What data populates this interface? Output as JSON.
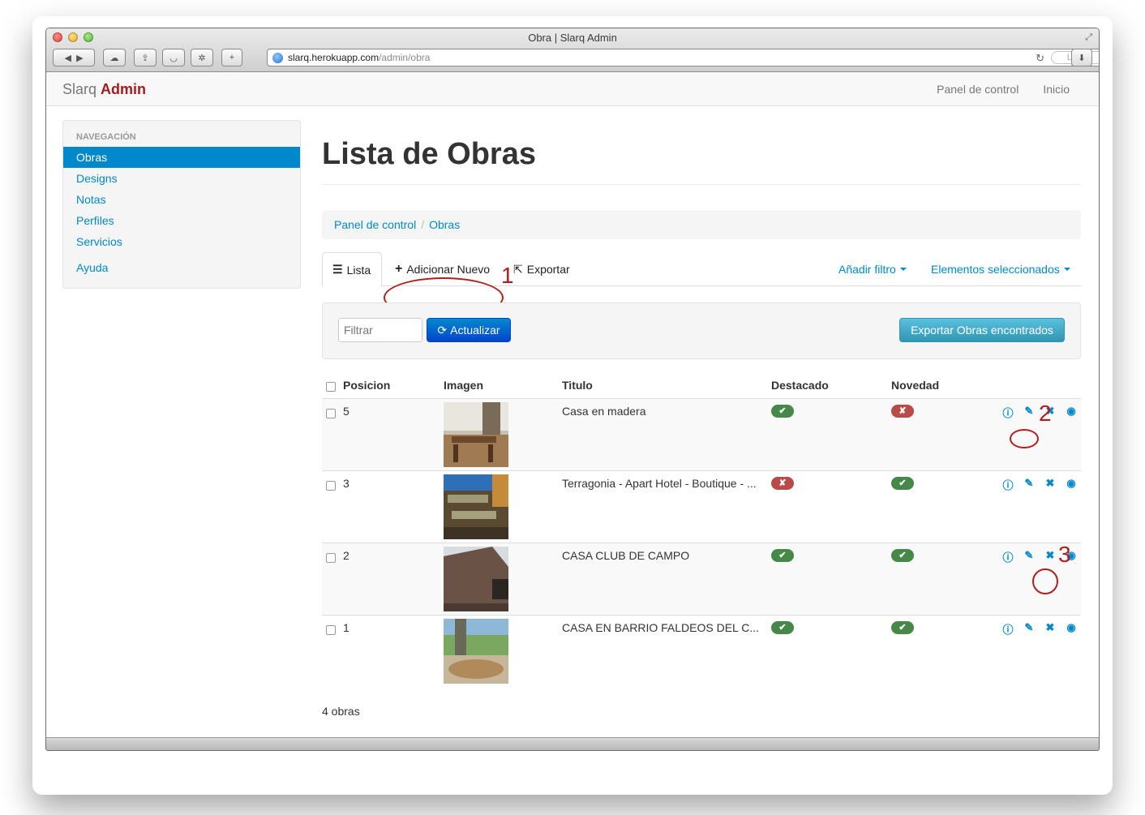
{
  "window": {
    "title": "Obra | Slarq Admin",
    "url_host": "slarq.herokuapp.com",
    "url_path": "/admin/obra",
    "reader_label": "Lector"
  },
  "navbar": {
    "brand_light": "Slarq",
    "brand_bold": "Admin",
    "links": [
      "Panel de control",
      "Inicio"
    ]
  },
  "sidebar": {
    "header": "NAVEGACIÓN",
    "items": [
      "Obras",
      "Designs",
      "Notas",
      "Perfiles",
      "Servicios"
    ],
    "help": "Ayuda"
  },
  "main": {
    "title": "Lista de Obras",
    "breadcrumb": [
      "Panel de control",
      "Obras"
    ],
    "tabs": {
      "list": "Lista",
      "add": "Adicionar Nuevo",
      "export": "Exportar",
      "add_filter": "Añadir filtro",
      "selected": "Elementos seleccionados"
    },
    "filter": {
      "placeholder": "Filtrar",
      "refresh": "Actualizar",
      "export_found": "Exportar Obras encontrados"
    },
    "columns": [
      "Posicion",
      "Imagen",
      "Titulo",
      "Destacado",
      "Novedad"
    ],
    "rows": [
      {
        "position": "5",
        "title": "Casa en madera",
        "featured": true,
        "new": false
      },
      {
        "position": "3",
        "title": "Terragonia - Apart Hotel - Boutique - ...",
        "featured": false,
        "new": true
      },
      {
        "position": "2",
        "title": "CASA CLUB DE CAMPO",
        "featured": true,
        "new": true
      },
      {
        "position": "1",
        "title": "CASA EN BARRIO FALDEOS DEL C...",
        "featured": true,
        "new": true
      }
    ],
    "count": "4 obras"
  },
  "annotations": [
    "1",
    "2",
    "3"
  ],
  "colors": {
    "link": "#0088cc",
    "brand": "#a51c1c",
    "success": "#468847",
    "danger": "#b94a48",
    "annotation": "#b01e1e"
  }
}
